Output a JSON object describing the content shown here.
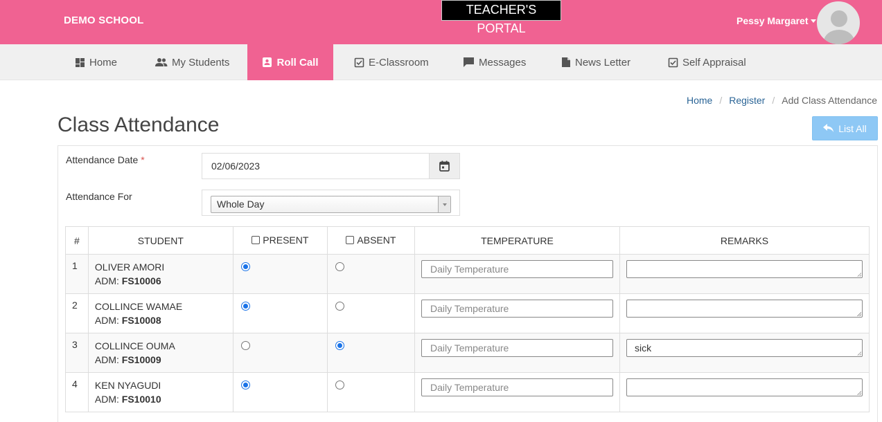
{
  "header": {
    "school_name": "DEMO SCHOOL",
    "portal_title": "TEACHER'S PORTAL",
    "user_name": "Pessy Margaret"
  },
  "nav": {
    "items": [
      {
        "label": "Home",
        "icon": "dashboard-icon"
      },
      {
        "label": "My Students",
        "icon": "people-icon"
      },
      {
        "label": "Roll Call",
        "icon": "roll-call-icon",
        "active": true
      },
      {
        "label": "E-Classroom",
        "icon": "checkbox-icon"
      },
      {
        "label": "Messages",
        "icon": "chat-icon"
      },
      {
        "label": "News Letter",
        "icon": "document-icon"
      },
      {
        "label": "Self Appraisal",
        "icon": "checkbox-icon"
      }
    ]
  },
  "breadcrumb": {
    "home": "Home",
    "register": "Register",
    "current": "Add Class Attendance"
  },
  "page": {
    "title": "Class Attendance",
    "list_all_label": "List All"
  },
  "form": {
    "date_label": "Attendance Date",
    "required_mark": "*",
    "date_value": "02/06/2023",
    "for_label": "Attendance For",
    "for_value": "Whole Day"
  },
  "table": {
    "headers": {
      "num": "#",
      "student": "STUDENT",
      "present": "PRESENT",
      "absent": "ABSENT",
      "temperature": "TEMPERATURE",
      "remarks": "REMARKS"
    },
    "temp_placeholder": "Daily Temperature",
    "adm_prefix": "ADM:",
    "rows": [
      {
        "num": "1",
        "name": "OLIVER AMORI",
        "adm": "FS10006",
        "status": "present",
        "remarks": ""
      },
      {
        "num": "2",
        "name": "COLLINCE WAMAE",
        "adm": "FS10008",
        "status": "present",
        "remarks": ""
      },
      {
        "num": "3",
        "name": "COLLINCE OUMA",
        "adm": "FS10009",
        "status": "absent",
        "remarks": "sick"
      },
      {
        "num": "4",
        "name": "KEN NYAGUDI",
        "adm": "FS10010",
        "status": "present",
        "remarks": ""
      }
    ]
  },
  "colors": {
    "brand": "#f06292",
    "radio_selected": "#1a73e8",
    "link": "#2a6496",
    "list_all_bg": "#8ec8f5"
  }
}
